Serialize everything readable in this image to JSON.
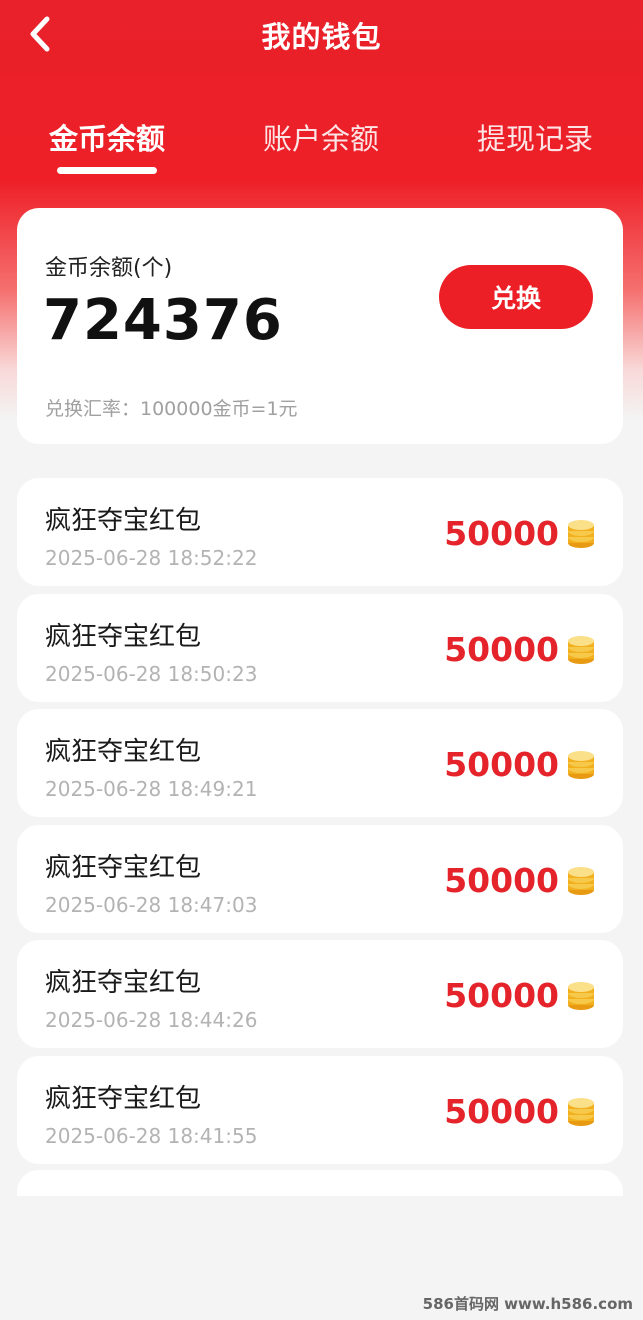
{
  "header": {
    "title": "我的钱包"
  },
  "tabs": [
    {
      "label": "金币余额",
      "active": true
    },
    {
      "label": "账户余额",
      "active": false
    },
    {
      "label": "提现记录",
      "active": false
    }
  ],
  "balance": {
    "label": "金币余额(个)",
    "value": "724376",
    "exchange_button": "兑换",
    "rate_text": "兑换汇率：100000金币=1元"
  },
  "records": [
    {
      "title": "疯狂夺宝红包",
      "time": "2025-06-28 18:52:22",
      "amount": "50000"
    },
    {
      "title": "疯狂夺宝红包",
      "time": "2025-06-28 18:50:23",
      "amount": "50000"
    },
    {
      "title": "疯狂夺宝红包",
      "time": "2025-06-28 18:49:21",
      "amount": "50000"
    },
    {
      "title": "疯狂夺宝红包",
      "time": "2025-06-28 18:47:03",
      "amount": "50000"
    },
    {
      "title": "疯狂夺宝红包",
      "time": "2025-06-28 18:44:26",
      "amount": "50000"
    },
    {
      "title": "疯狂夺宝红包",
      "time": "2025-06-28 18:41:55",
      "amount": "50000"
    }
  ],
  "watermark": "586首码网 www.h586.com",
  "colors": {
    "primary_red": "#ec1f27",
    "amount_red": "#e4232a",
    "coin_gold": "#f2b01e"
  },
  "icons": {
    "back": "chevron-left-icon",
    "coin": "coin-stack-icon"
  }
}
